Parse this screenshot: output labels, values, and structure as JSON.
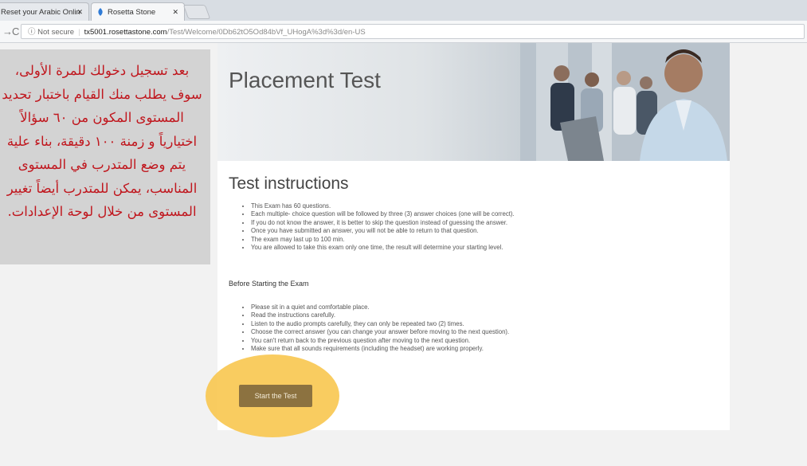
{
  "browser": {
    "tabs": [
      {
        "label": "Reset your Arabic Onlin",
        "active": false
      },
      {
        "label": "Rosetta Stone",
        "active": true
      }
    ],
    "security_label": "Not secure",
    "url_host": "tx5001.rosettastone.com",
    "url_path": "/Test/Welcome/0Db62tO5Od84bVf_UHogA%3d%3d/en-US"
  },
  "arabic_note": {
    "text": "بعد تسجيل دخولك للمرة الأولى، سوف يطلب منك القيام باختبار تحديد المستوى المكون من ٦٠ سؤالاً اختيارياً و زمنة ١٠٠ دقيقة، بناء علية يتم وضع المتدرب في المستوى المناسب، يمكن للمتدرب أيضاً تغيير المستوى من خلال لوحة الإعدادات."
  },
  "hero": {
    "title": "Placement Test"
  },
  "instructions": {
    "heading": "Test instructions",
    "items": [
      "This Exam has 60 questions.",
      "Each multiple- choice question will be followed by three (3) answer choices (one will be correct).",
      "If you do not know the answer, it is better to skip the question instead of guessing the answer.",
      "Once you have submitted an answer, you will not be able to return to that question.",
      "The exam may last up to 100 min.",
      "You are allowed to take this exam only one time, the result will determine your starting level."
    ]
  },
  "before": {
    "heading": "Before Starting the Exam",
    "items": [
      "Please sit in a quiet and comfortable place.",
      "Read the instructions carefully.",
      "Listen to the audio prompts carefully, they can only be repeated two (2) times.",
      "Choose the correct answer (you can change your answer before moving to the next question).",
      "You can't return back to the previous question after moving to the next question.",
      "Make sure that all sounds requirements (including the headset) are working properly."
    ]
  },
  "start_button": {
    "label": "Start the Test"
  },
  "colors": {
    "note_text": "#c0161d",
    "note_bg": "#d3d3d3",
    "button_bg": "#8c7240",
    "highlight": "#f8c852"
  }
}
